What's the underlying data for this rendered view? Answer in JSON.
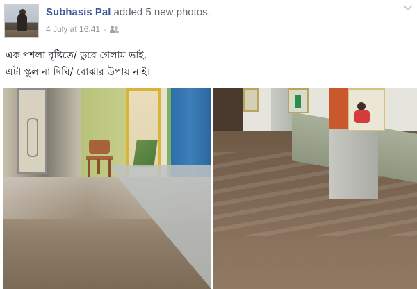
{
  "post": {
    "author": "Subhasis Pal",
    "action": " added 5 new photos.",
    "timestamp": "4 July at 16:41",
    "meta_separator": "·",
    "audience_icon": "friends-icon",
    "options_icon": "chevron-down-icon",
    "caption_lines": [
      "এক পশলা বৃষ্টিতে/ ডুবে গেলাম ভাই,",
      "এটা স্কুল না দিঘি/ বোঝার উপায় নাই।"
    ]
  },
  "photos": [
    {
      "name": "flooded-corridor-photo"
    },
    {
      "name": "flooded-verandah-photo"
    }
  ],
  "colors": {
    "author_link": "#3b5998",
    "meta_text": "#90949c",
    "body_text": "#1d2129",
    "header_text": "#616770"
  }
}
